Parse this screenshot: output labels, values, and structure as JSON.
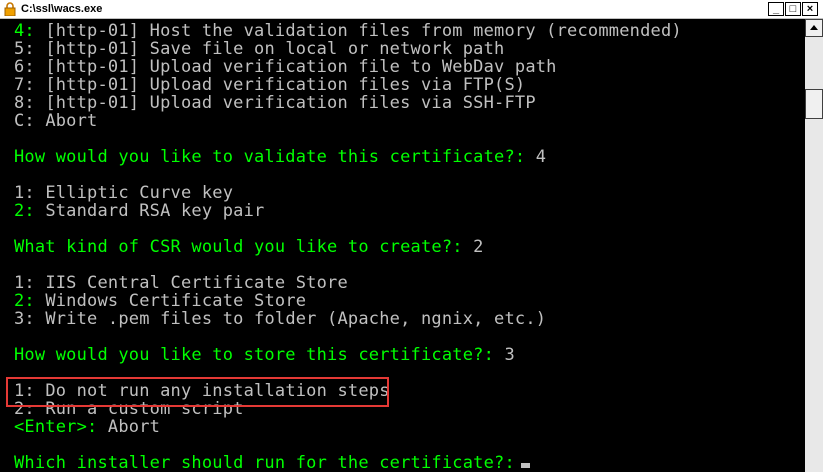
{
  "window": {
    "title": "C:\\ssl\\wacs.exe"
  },
  "lines": [
    {
      "num": "4:",
      "text": "[http-01] Host the validation files from memory (recommended)"
    },
    {
      "num": "5:",
      "text": "[http-01] Save file on local or network path"
    },
    {
      "num": "6:",
      "text": "[http-01] Upload verification file to WebDav path"
    },
    {
      "num": "7:",
      "text": "[http-01] Upload verification files via FTP(S)"
    },
    {
      "num": "8:",
      "text": "[http-01] Upload verification files via SSH-FTP"
    },
    {
      "num": "C:",
      "text": "Abort"
    },
    {
      "prompt": "How would you like to validate this certificate?:",
      "answer": "4"
    },
    {
      "num": "1:",
      "text": "Elliptic Curve key"
    },
    {
      "num": "2:",
      "text": "Standard RSA key pair"
    },
    {
      "prompt": "What kind of CSR would you like to create?:",
      "answer": "2"
    },
    {
      "num": "1:",
      "text": "IIS Central Certificate Store"
    },
    {
      "num": "2:",
      "text": "Windows Certificate Store"
    },
    {
      "num": "3:",
      "text": "Write .pem files to folder (Apache, ngnix, etc.)"
    },
    {
      "prompt": "How would you like to store this certificate?:",
      "answer": "3"
    },
    {
      "num": "1:",
      "text": "Do not run any installation steps"
    },
    {
      "num": "2:",
      "text": "Run a custom script"
    },
    {
      "num": "<Enter>:",
      "text": "Abort"
    },
    {
      "prompt": "Which installer should run for the certificate?:",
      "answer": ""
    }
  ],
  "colors": {
    "background": "#000000",
    "text": "#c0c0c0",
    "highlight_green": "#00ff00",
    "annotation_box": "#e53935"
  }
}
